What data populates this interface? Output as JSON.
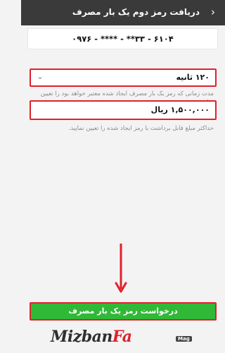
{
  "header": {
    "title": "دریافت رمز دوم یک بار مصرف",
    "back_glyph": "‹"
  },
  "card": {
    "number": "۶۱۰۴ - ۳۳** - **** - ۰۹۷۶"
  },
  "validity": {
    "value": "۱۲۰ ثانیه",
    "hint": "مدت زمانی که رمز یک بار مصرف ایجاد شده معتبر خواهد بود را تعیین نمایید."
  },
  "amount": {
    "value": "۱,۵۰۰,۰۰۰ ریال",
    "hint": "حداکثر مبلغ قابل برداشت با رمز ایجاد شده را تعیین نمایید."
  },
  "submit": {
    "label": "درخواست رمز یک بار مصرف"
  },
  "watermark": {
    "brand_main": "Mizban",
    "brand_accent": "Fa",
    "tag": "Mag"
  },
  "colors": {
    "header_bg": "#3a3a3a",
    "highlight_red": "#e0212b",
    "button_green": "#2fb936"
  }
}
